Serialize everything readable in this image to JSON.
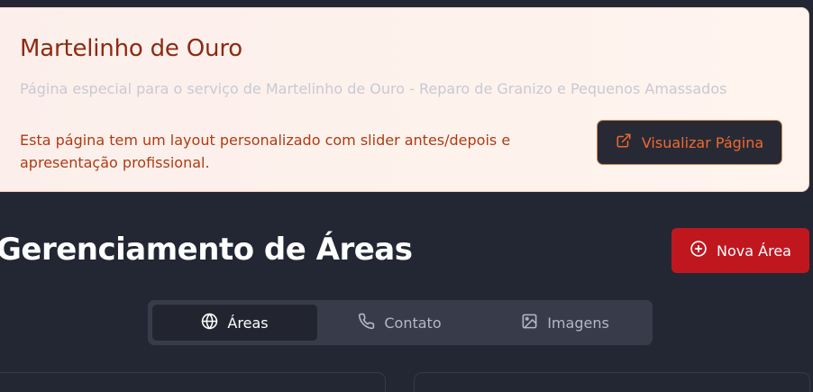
{
  "info_card": {
    "title": "Martelinho de Ouro",
    "subtitle": "Página especial para o serviço de Martelinho de Ouro - Reparo de Granizo e Pequenos Amassados",
    "description": "Esta página tem um layout personalizado com slider antes/depois e apresentação profissional.",
    "view_button_label": "Visualizar Página",
    "view_button_icon": "external-link-icon"
  },
  "header": {
    "title": "Gerenciamento de Áreas",
    "new_button_label": "Nova Área",
    "new_button_icon": "plus-circle-icon"
  },
  "tabs": [
    {
      "label": "Áreas",
      "icon": "globe-icon",
      "active": true
    },
    {
      "label": "Contato",
      "icon": "phone-icon",
      "active": false
    },
    {
      "label": "Imagens",
      "icon": "image-icon",
      "active": false
    }
  ],
  "colors": {
    "page_background": "#232733",
    "card_background": "#fcefeb",
    "card_title": "#8e2a12",
    "card_text": "#b13a12",
    "accent_orange": "#f0682f",
    "primary_red": "#c0171f",
    "tab_bar": "#383c4a",
    "tab_active": "#222530"
  }
}
